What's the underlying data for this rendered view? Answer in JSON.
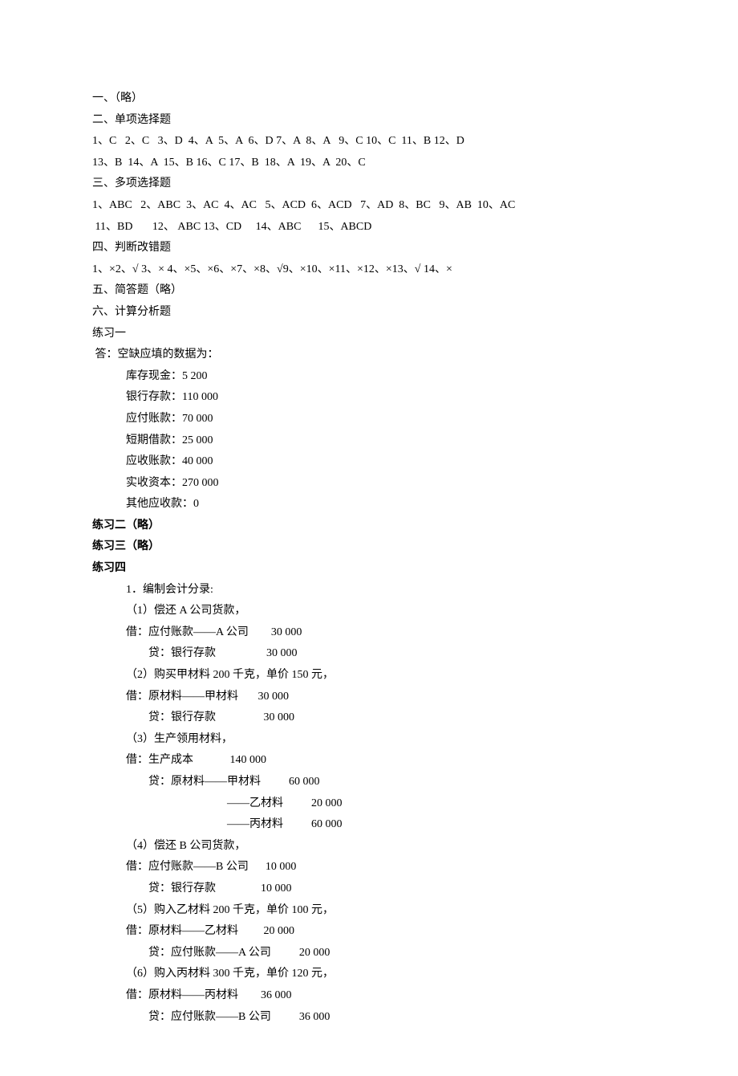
{
  "section1": "一、（略）",
  "section2_title": "二、单项选择题",
  "section2_line1": "1、C   2、C   3、D  4、A  5、A  6、D 7、A  8、A   9、C 10、C  11、B 12、D",
  "section2_line2": "13、B  14、A  15、B 16、C 17、B  18、A  19、A  20、C",
  "section3_title": "三、多项选择题",
  "section3_line1": "1、ABC   2、ABC  3、AC  4、AC   5、ACD  6、ACD   7、AD  8、BC   9、AB  10、AC",
  "section3_line2": " 11、BD       12、 ABC 13、CD     14、ABC      15、ABCD",
  "section4_title": "四、判断改错题",
  "section4_line1": "1、×2、√ 3、× 4、×5、×6、×7、×8、√9、×10、×11、×12、×13、√ 14、×",
  "section5": "五、简答题（略）",
  "section6_title": "六、计算分析题",
  "ex1_title": "练习一",
  "ex1_ans": " 答：空缺应填的数据为：",
  "ex1_items": [
    "库存现金：5 200",
    "银行存款：110 000",
    "应付账款：70 000",
    "短期借款：25 000",
    "应收账款：40 000",
    "实收资本：270 000",
    "其他应收款：0"
  ],
  "ex2": "练习二（略）",
  "ex3": "练习三（略）",
  "ex4_title": "练习四",
  "ex4_item1": "1．编制会计分录:",
  "ex4_e1_desc": "（1）偿还 A 公司货款，",
  "ex4_e1_dr": "借：应付账款——A 公司        30 000",
  "ex4_e1_cr": "贷：银行存款                  30 000",
  "ex4_e2_desc": "（2）购买甲材料 200 千克，单价 150 元，",
  "ex4_e2_dr": "借：原材料——甲材料       30 000",
  "ex4_e2_cr": "贷：银行存款                 30 000",
  "ex4_e3_desc": "（3）生产领用材料，",
  "ex4_e3_dr": "借：生产成本             140 000",
  "ex4_e3_cr1": "贷：原材料——甲材料          60 000",
  "ex4_e3_cr2": "——乙材料          20 000",
  "ex4_e3_cr3": "——丙材料          60 000",
  "ex4_e4_desc": "（4）偿还 B 公司货款，",
  "ex4_e4_dr": "借：应付账款——B 公司      10 000",
  "ex4_e4_cr": "贷：银行存款                10 000",
  "ex4_e5_desc": "（5）购入乙材料 200 千克，单价 100 元，",
  "ex4_e5_dr": "借：原材料——乙材料         20 000",
  "ex4_e5_cr": "贷：应付账款——A 公司          20 000",
  "ex4_e6_desc": "（6）购入丙材料 300 千克，单价 120 元，",
  "ex4_e6_dr": "借：原材料——丙材料        36 000",
  "ex4_e6_cr": "贷：应付账款——B 公司          36 000"
}
